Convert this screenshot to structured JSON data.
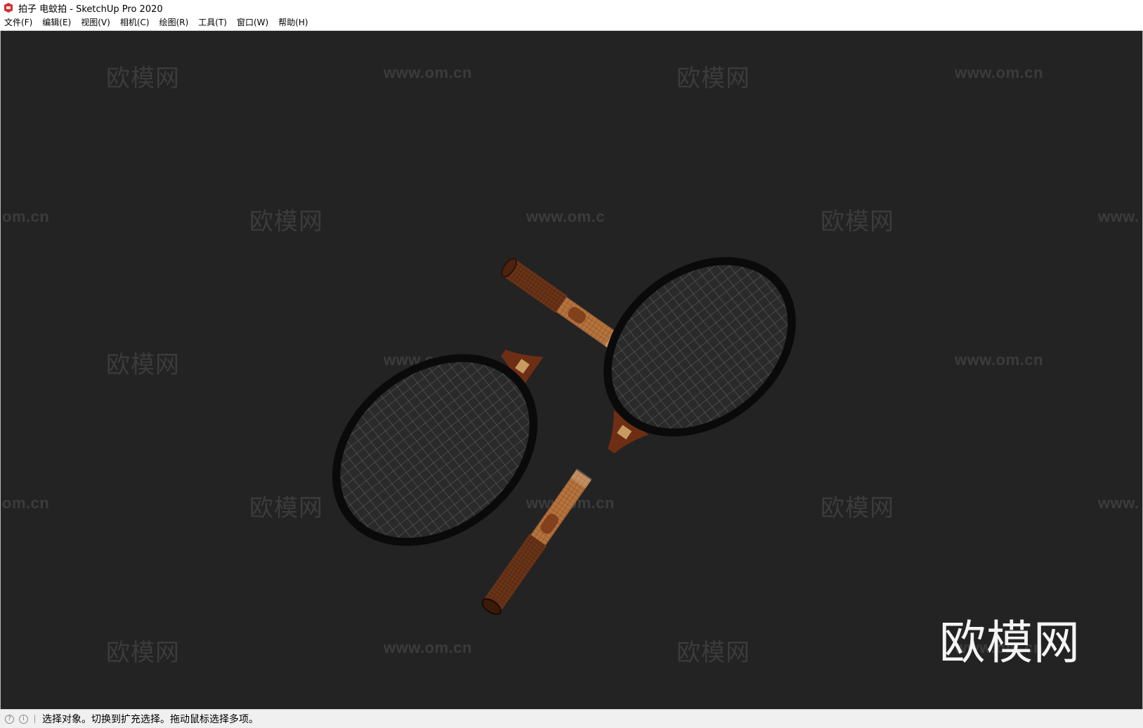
{
  "window": {
    "title": "拍子 电蚊拍 - SketchUp Pro 2020",
    "icon": "sketchup-logo-icon"
  },
  "menu": [
    {
      "label": "文件(F)"
    },
    {
      "label": "编辑(E)"
    },
    {
      "label": "视图(V)"
    },
    {
      "label": "相机(C)"
    },
    {
      "label": "绘图(R)"
    },
    {
      "label": "工具(T)"
    },
    {
      "label": "窗口(W)"
    },
    {
      "label": "帮助(H)"
    }
  ],
  "viewport": {
    "background": "#232323",
    "watermark_cn": "欧模网",
    "watermark_url": "www.om.cn",
    "watermark_url_partial_left": "om.cn",
    "watermark_url_partial_right": "www.",
    "watermark_url_clipped": "www.om.c",
    "logo_text": "欧模网",
    "model": "two wooden tennis rackets"
  },
  "status": {
    "icons": [
      "geo-location-icon",
      "info-icon"
    ],
    "text": "选择对象。切换到扩充选择。拖动鼠标选择多项。"
  },
  "colors": {
    "wood": "#c9884f",
    "wood_dark": "#6b3416",
    "frame": "#0c0c0c",
    "strings": "#555555"
  }
}
